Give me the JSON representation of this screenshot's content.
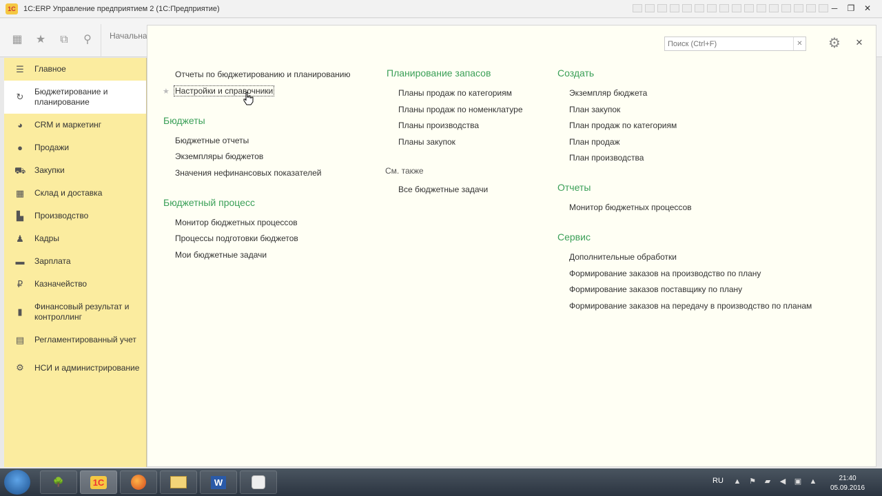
{
  "window": {
    "title": "1С:ERP Управление предприятием 2  (1С:Предприятие)",
    "logo_text": "1С"
  },
  "toolbar": {
    "start_tab_label": "Начальна"
  },
  "sidebar": {
    "items": [
      {
        "label": "Главное",
        "icon": "menu-icon"
      },
      {
        "label": "Бюджетирование и планирование",
        "icon": "budget-icon"
      },
      {
        "label": "CRM и маркетинг",
        "icon": "crm-icon"
      },
      {
        "label": "Продажи",
        "icon": "sales-icon"
      },
      {
        "label": "Закупки",
        "icon": "cart-icon"
      },
      {
        "label": "Склад и доставка",
        "icon": "warehouse-icon"
      },
      {
        "label": "Производство",
        "icon": "factory-icon"
      },
      {
        "label": "Кадры",
        "icon": "staff-icon"
      },
      {
        "label": "Зарплата",
        "icon": "salary-icon"
      },
      {
        "label": "Казначейство",
        "icon": "treasury-icon"
      },
      {
        "label": "Финансовый результат и контроллинг",
        "icon": "finance-chart-icon"
      },
      {
        "label": "Регламентированный учет",
        "icon": "accounting-icon"
      },
      {
        "label": "НСИ и администрирование",
        "icon": "gear-icon"
      }
    ]
  },
  "search": {
    "placeholder": "Поиск (Ctrl+F)"
  },
  "column1": {
    "top_links": [
      "Отчеты по бюджетированию и планированию",
      "Настройки и справочники"
    ],
    "sections": [
      {
        "title": "Бюджеты",
        "links": [
          "Бюджетные отчеты",
          "Экземпляры бюджетов",
          "Значения нефинансовых показателей"
        ]
      },
      {
        "title": "Бюджетный процесс",
        "links": [
          "Монитор бюджетных процессов",
          "Процессы подготовки бюджетов",
          "Мои бюджетные задачи"
        ]
      }
    ]
  },
  "column2": {
    "sections": [
      {
        "title": "Планирование запасов",
        "links": [
          "Планы продаж по категориям",
          "Планы продаж по номенклатуре",
          "Планы производства",
          "Планы закупок"
        ]
      }
    ],
    "see_also_label": "См. также",
    "see_also_links": [
      "Все бюджетные задачи"
    ]
  },
  "column3": {
    "sections": [
      {
        "title": "Создать",
        "links": [
          "Экземпляр бюджета",
          "План закупок",
          "План продаж по категориям",
          "План продаж",
          "План производства"
        ]
      },
      {
        "title": "Отчеты",
        "links": [
          "Монитор бюджетных процессов"
        ]
      },
      {
        "title": "Сервис",
        "links": [
          "Дополнительные обработки",
          "Формирование заказов на производство по плану",
          "Формирование заказов поставщику по плану",
          "Формирование заказов на передачу в производство по планам"
        ]
      }
    ]
  },
  "taskbar": {
    "apps": [
      {
        "name": "explorer-tree",
        "label": ""
      },
      {
        "name": "1c",
        "label": "1С"
      },
      {
        "name": "firefox",
        "label": ""
      },
      {
        "name": "file-explorer",
        "label": ""
      },
      {
        "name": "word",
        "label": "W"
      },
      {
        "name": "paint",
        "label": ""
      }
    ],
    "language": "RU",
    "time": "21:40",
    "date": "05.09.2016"
  },
  "colors": {
    "accent_green": "#3a9f57",
    "sidebar_bg": "#fbec9f",
    "main_bg": "#fffff4"
  }
}
